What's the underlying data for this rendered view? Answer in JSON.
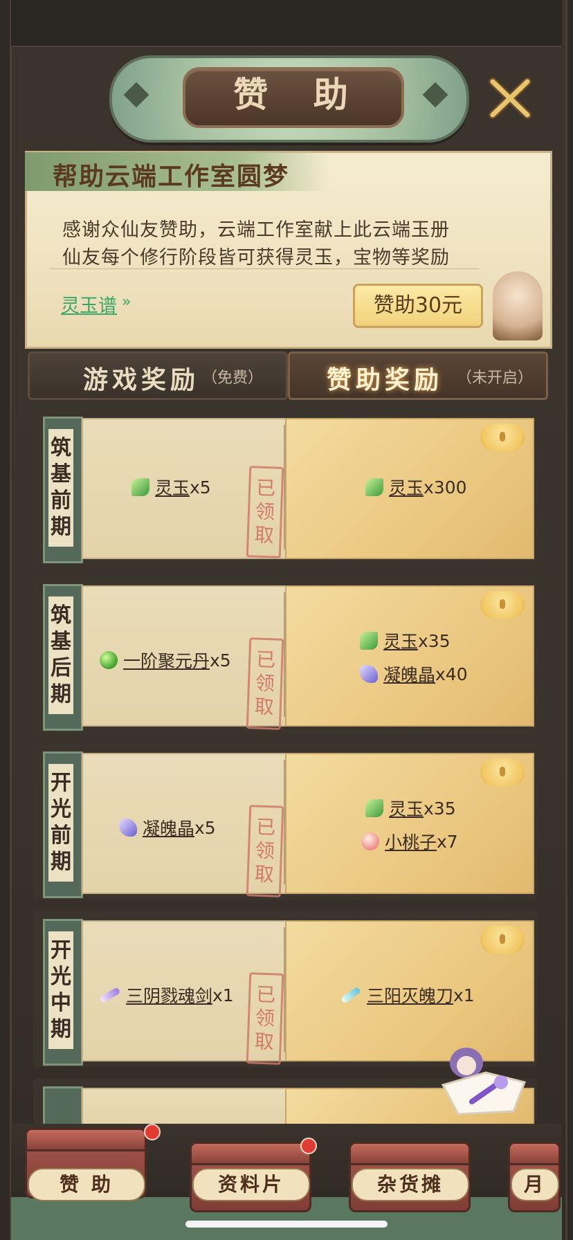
{
  "header": {
    "title": "赞 助"
  },
  "banner": {
    "title": "帮助云端工作室圆梦",
    "line1": "感谢众仙友赞助，云端工作室献上此云端玉册",
    "line2": "仙友每个修行阶段皆可获得灵玉，宝物等奖励",
    "link_label": "灵玉谱",
    "link_arrow": "»",
    "sponsor_button_label": "赞助30元"
  },
  "tabs": {
    "game": {
      "label": "游戏奖励",
      "sub": "（免费）"
    },
    "sponsor": {
      "label": "赞助奖励",
      "sub": "（未开启）"
    }
  },
  "rows": [
    {
      "stage": [
        "筑",
        "基",
        "前",
        "期"
      ],
      "claimed": [
        "已",
        "领",
        "取"
      ],
      "free": [
        {
          "icon": "jade-icon",
          "name": "灵玉",
          "qty": "x5"
        }
      ],
      "paid": [
        {
          "icon": "jade-icon",
          "name": "灵玉",
          "qty": "x300"
        }
      ]
    },
    {
      "stage": [
        "筑",
        "基",
        "后",
        "期"
      ],
      "claimed": [
        "已",
        "领",
        "取"
      ],
      "free": [
        {
          "icon": "pill-icon",
          "name": "一阶聚元丹",
          "qty": "x5"
        }
      ],
      "paid": [
        {
          "icon": "jade-icon",
          "name": "灵玉",
          "qty": "x35"
        },
        {
          "icon": "crystal-icon",
          "name": "凝魄晶",
          "qty": "x40"
        }
      ]
    },
    {
      "stage": [
        "开",
        "光",
        "前",
        "期"
      ],
      "claimed": [
        "已",
        "领",
        "取"
      ],
      "free": [
        {
          "icon": "crystal-icon",
          "name": "凝魄晶",
          "qty": "x5"
        }
      ],
      "paid": [
        {
          "icon": "jade-icon",
          "name": "灵玉",
          "qty": "x35"
        },
        {
          "icon": "peach-icon",
          "name": "小桃子",
          "qty": "x7"
        }
      ]
    },
    {
      "stage": [
        "开",
        "光",
        "中",
        "期"
      ],
      "claimed": [
        "已",
        "领",
        "取"
      ],
      "free": [
        {
          "icon": "sword-icon",
          "name": "三阴戮魂剑",
          "qty": "x1"
        }
      ],
      "paid": [
        {
          "icon": "blade-icon",
          "name": "三阳灭魄刀",
          "qty": "x1"
        }
      ]
    }
  ],
  "bottom_nav": [
    {
      "label": "赞 助",
      "badge": true
    },
    {
      "label": "资料片",
      "badge": true
    },
    {
      "label": "杂货摊",
      "badge": false
    },
    {
      "label": "月",
      "badge": false
    }
  ],
  "colors": {
    "frame": "#3b342d",
    "plaque_green": "#a7c2a1",
    "banner": "#f5ecd0",
    "link_green": "#3aa66a",
    "gold": "#e9c57c",
    "stamp_red": "#cf6c5d",
    "badge_red": "#e23b31"
  }
}
